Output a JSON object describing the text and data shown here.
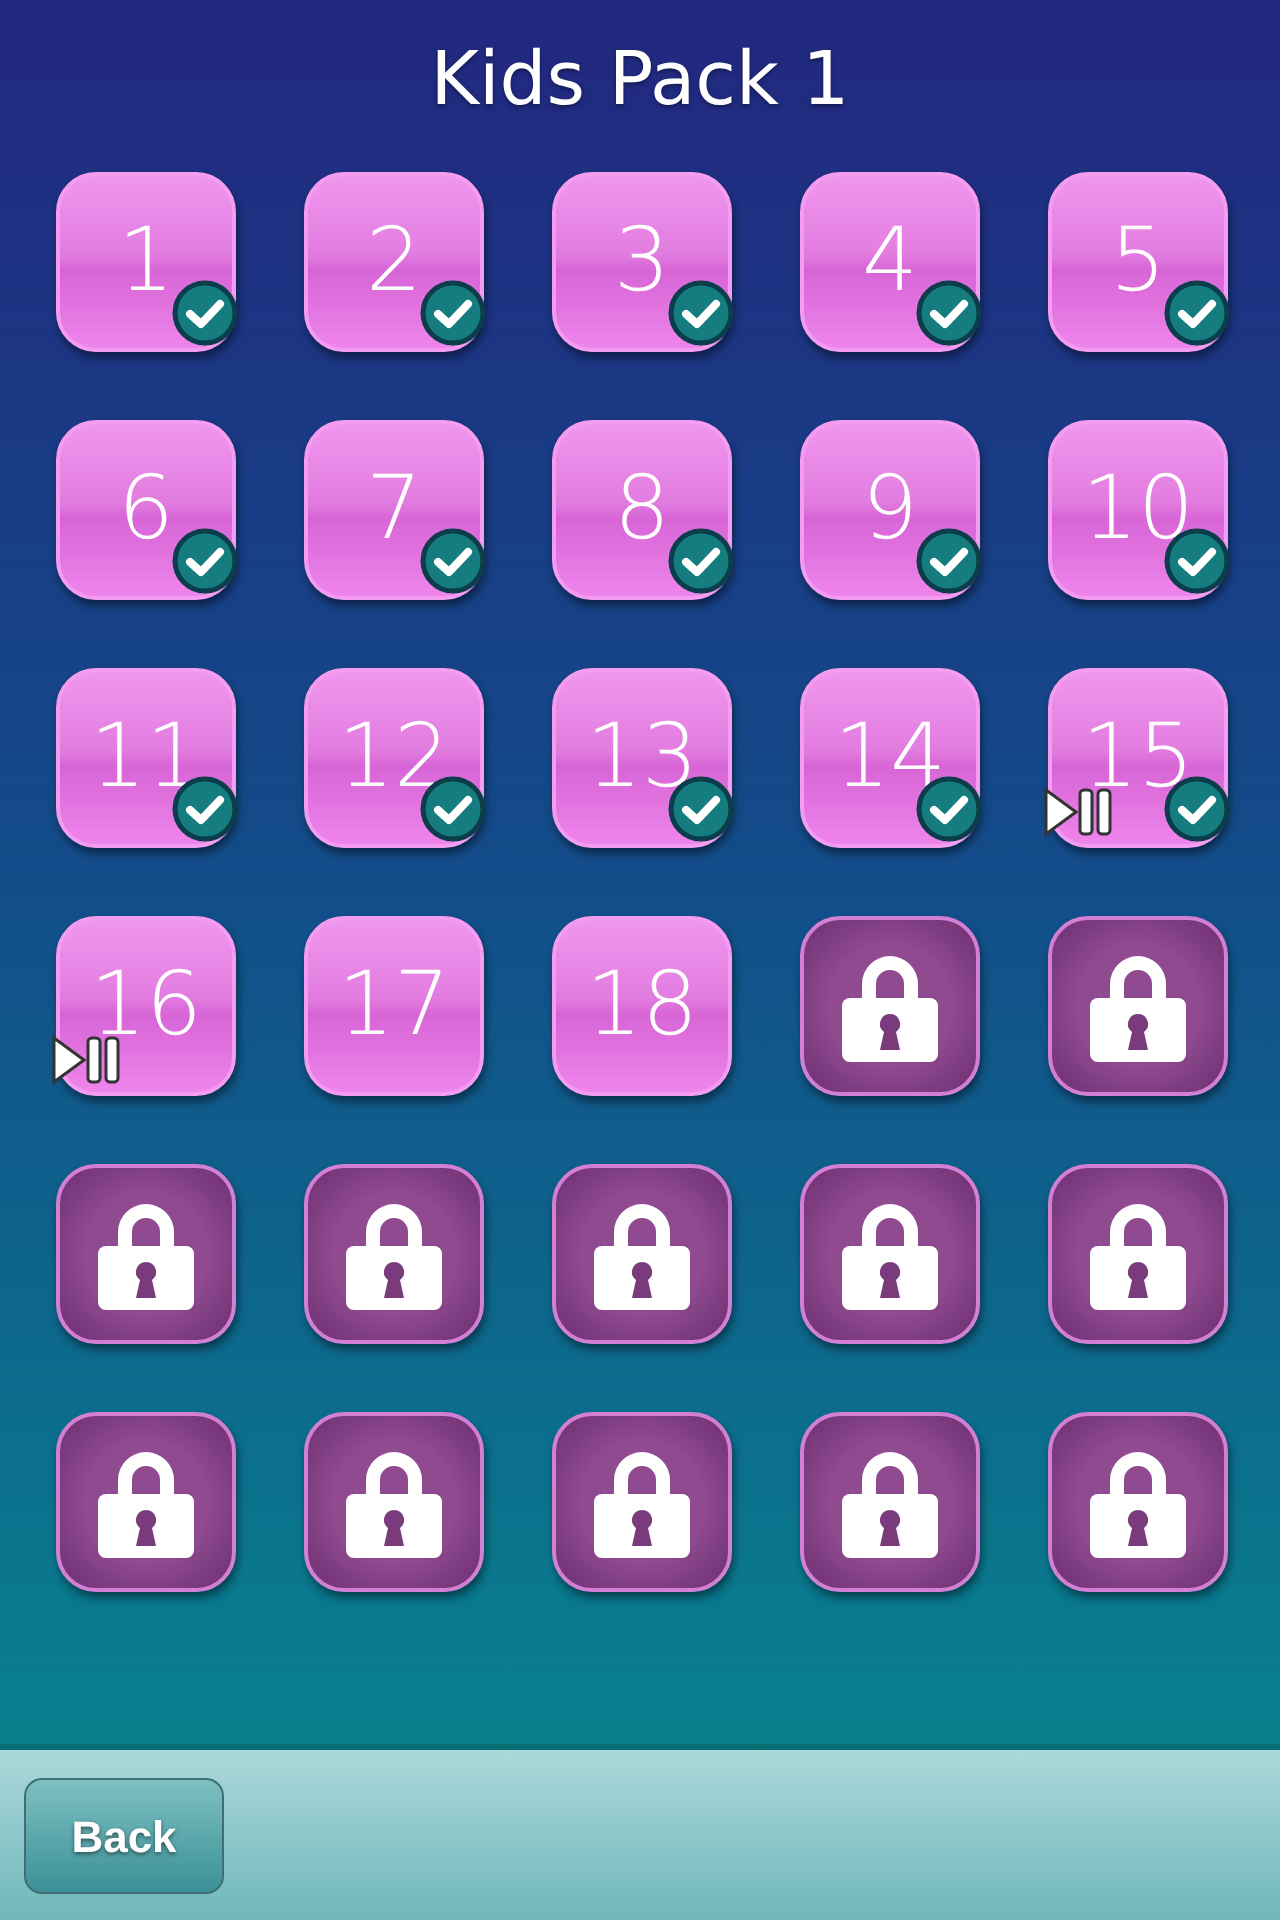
{
  "title": "Kids Pack 1",
  "levels": [
    {
      "kind": "open",
      "label": "1",
      "completed": true,
      "in_progress": false
    },
    {
      "kind": "open",
      "label": "2",
      "completed": true,
      "in_progress": false
    },
    {
      "kind": "open",
      "label": "3",
      "completed": true,
      "in_progress": false
    },
    {
      "kind": "open",
      "label": "4",
      "completed": true,
      "in_progress": false
    },
    {
      "kind": "open",
      "label": "5",
      "completed": true,
      "in_progress": false
    },
    {
      "kind": "open",
      "label": "6",
      "completed": true,
      "in_progress": false
    },
    {
      "kind": "open",
      "label": "7",
      "completed": true,
      "in_progress": false
    },
    {
      "kind": "open",
      "label": "8",
      "completed": true,
      "in_progress": false
    },
    {
      "kind": "open",
      "label": "9",
      "completed": true,
      "in_progress": false
    },
    {
      "kind": "open",
      "label": "10",
      "completed": true,
      "in_progress": false
    },
    {
      "kind": "open",
      "label": "11",
      "completed": true,
      "in_progress": false
    },
    {
      "kind": "open",
      "label": "12",
      "completed": true,
      "in_progress": false
    },
    {
      "kind": "open",
      "label": "13",
      "completed": true,
      "in_progress": false
    },
    {
      "kind": "open",
      "label": "14",
      "completed": true,
      "in_progress": false
    },
    {
      "kind": "open",
      "label": "15",
      "completed": true,
      "in_progress": true
    },
    {
      "kind": "open",
      "label": "16",
      "completed": false,
      "in_progress": true
    },
    {
      "kind": "open",
      "label": "17",
      "completed": false,
      "in_progress": false
    },
    {
      "kind": "open",
      "label": "18",
      "completed": false,
      "in_progress": false
    },
    {
      "kind": "locked"
    },
    {
      "kind": "locked"
    },
    {
      "kind": "locked"
    },
    {
      "kind": "locked"
    },
    {
      "kind": "locked"
    },
    {
      "kind": "locked"
    },
    {
      "kind": "locked"
    },
    {
      "kind": "locked"
    },
    {
      "kind": "locked"
    },
    {
      "kind": "locked"
    },
    {
      "kind": "locked"
    },
    {
      "kind": "locked"
    }
  ],
  "back_button": "Back"
}
